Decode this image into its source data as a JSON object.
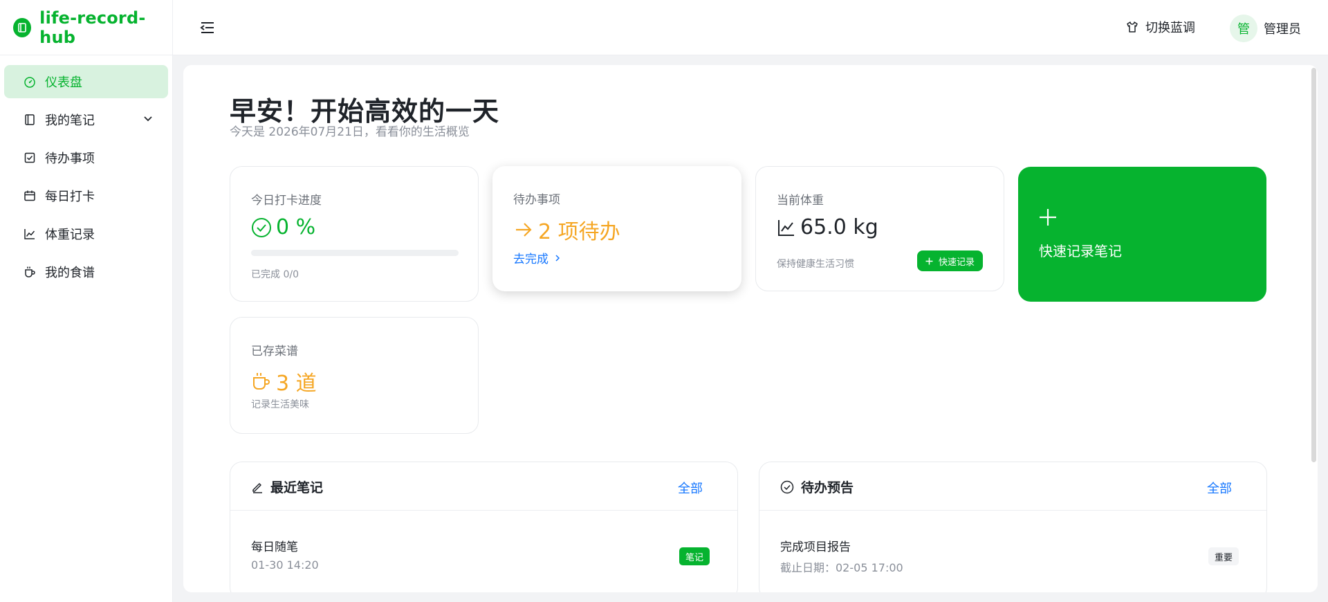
{
  "app": {
    "name": "life-record-hub"
  },
  "sidebar": {
    "items": [
      {
        "label": "仪表盘",
        "icon": "dashboard-icon",
        "active": true
      },
      {
        "label": "我的笔记",
        "icon": "notebook-icon",
        "expandable": true
      },
      {
        "label": "待办事项",
        "icon": "checkbox-icon"
      },
      {
        "label": "每日打卡",
        "icon": "calendar-icon"
      },
      {
        "label": "体重记录",
        "icon": "line-chart-icon"
      },
      {
        "label": "我的食谱",
        "icon": "cup-icon"
      }
    ]
  },
  "header": {
    "theme_label": "切换蓝调",
    "avatar_text": "管",
    "username": "管理员"
  },
  "main": {
    "greeting": "早安！开始高效的一天",
    "subtitle": "今天是 2026年07月21日，看看你的生活概览",
    "cards": {
      "checkin": {
        "title": "今日打卡进度",
        "value": "0 %",
        "progress": 0,
        "note": "已完成 0/0"
      },
      "todo": {
        "title": "待办事项",
        "value": "2 项待办",
        "link": "去完成"
      },
      "weight": {
        "title": "当前体重",
        "value": "65.0 kg",
        "note": "保持健康生活习惯",
        "button": "快速记录"
      },
      "quick_note": {
        "label": "快速记录笔记"
      },
      "recipes": {
        "title": "已存菜谱",
        "value": "3 道",
        "note": "记录生活美味"
      }
    },
    "recent_notes": {
      "title": "最近笔记",
      "all_label": "全部",
      "items": [
        {
          "title": "每日随笔",
          "time": "01-30 14:20",
          "tag": "笔记"
        }
      ]
    },
    "todo_preview": {
      "title": "待办预告",
      "all_label": "全部",
      "items": [
        {
          "title": "完成项目报告",
          "deadline": "截止日期：02-05 17:00",
          "tag": "重要"
        }
      ]
    }
  },
  "colors": {
    "primary": "#06b32f",
    "accent_orange": "#f5a623",
    "link_blue": "#1677ff"
  }
}
